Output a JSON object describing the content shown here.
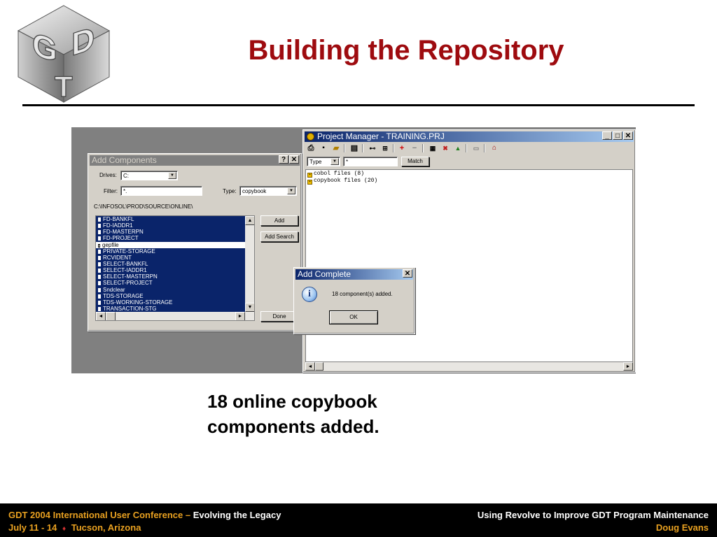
{
  "slide": {
    "logo_text": "GDT",
    "title": "Building the Repository",
    "caption_line1": "18 online copybook",
    "caption_line2": "components added."
  },
  "add_components": {
    "title": "Add Components",
    "help_btn": "?",
    "close_btn": "✕",
    "drives_label": "Drives:",
    "drives_value": "C:",
    "filter_label": "Filter:",
    "filter_value": "*.",
    "type_label": "Type:",
    "type_value": "copybook",
    "path": "C:\\INFOSOL\\PROD\\SOURCE\\ONLINE\\",
    "files": [
      {
        "name": "FD-BANKFL",
        "selected": true
      },
      {
        "name": "FD-IADDR1",
        "selected": true
      },
      {
        "name": "FD-MASTERPN",
        "selected": true
      },
      {
        "name": "FD-PROJECT",
        "selected": true
      },
      {
        "name": "gepfile",
        "selected": false
      },
      {
        "name": "PRIVATE-STORAGE",
        "selected": true
      },
      {
        "name": "RCVIDENT",
        "selected": true
      },
      {
        "name": "SELECT-BANKFL",
        "selected": true
      },
      {
        "name": "SELECT-IADDR1",
        "selected": true
      },
      {
        "name": "SELECT-MASTERPN",
        "selected": true
      },
      {
        "name": "SELECT-PROJECT",
        "selected": true
      },
      {
        "name": "Sndclear",
        "selected": true
      },
      {
        "name": "TDS-STORAGE",
        "selected": true
      },
      {
        "name": "TDS-WORKING-STORAGE",
        "selected": true
      },
      {
        "name": "TRANSACTION-STG",
        "selected": true
      }
    ],
    "add_button": "Add",
    "add_search_button": "Add Search",
    "done_button": "Done"
  },
  "project_manager": {
    "title": "Project Manager - TRAINING.PRJ",
    "min_btn": "_",
    "max_btn": "□",
    "close_btn": "✕",
    "filter_type": "Type",
    "filter_value": "*",
    "match_button": "Match",
    "tree": [
      "cobol files (8)",
      "copybook files (20)"
    ]
  },
  "add_complete": {
    "title": "Add Complete",
    "close_btn": "✕",
    "message": "18 component(s) added.",
    "ok_button": "OK",
    "icon": "info-icon"
  },
  "footer": {
    "left_line1_prefix": "GDT 2004 International User Conference –",
    "left_line1_suffix": "Evolving the Legacy",
    "left_line2_dates": "July 11 - 14",
    "left_line2_sep": "♦",
    "left_line2_place": "Tucson, Arizona",
    "right_line1": "Using Revolve to Improve GDT Program Maintenance",
    "right_line2": "Doug Evans"
  },
  "colors": {
    "title": "#9e0b0f",
    "footer_accent": "#e8a020",
    "selection": "#0a246a",
    "window_face": "#d4d0c8"
  }
}
